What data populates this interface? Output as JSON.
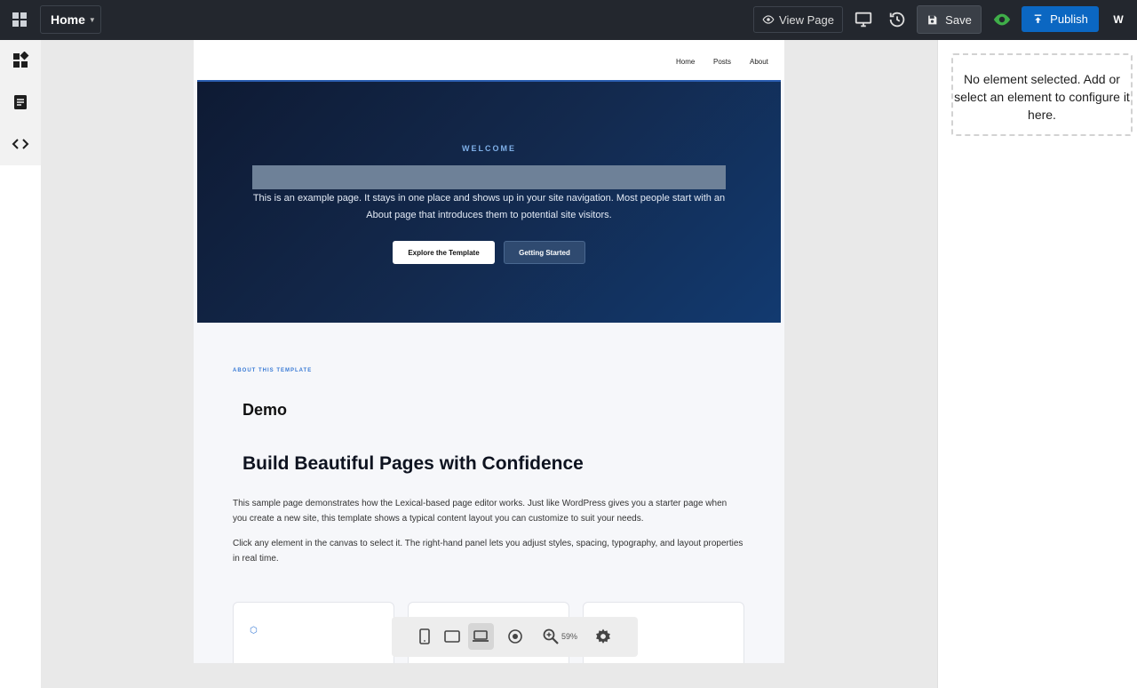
{
  "topbar": {
    "page_selector": "Home",
    "view_page": "View Page",
    "save": "Save",
    "publish": "Publish",
    "avatar": "W",
    "icons": [
      "dashboard-grid-icon",
      "eye-icon",
      "desktop-monitor-icon",
      "history-icon",
      "save-disk-icon",
      "visibility-eye-icon",
      "upload-icon"
    ]
  },
  "sidebar": {
    "icons": [
      "blocks-icon",
      "pages-document-icon",
      "code-icon"
    ]
  },
  "canvas": {
    "nav": {
      "items": [
        "Home",
        "Posts",
        "About"
      ]
    },
    "hero": {
      "welcome": "WELCOME",
      "text": "This is an example page. It stays in one place and shows up in your site navigation. Most people start with an About page that introduces them to potential site visitors.",
      "button_primary": "Explore the Template",
      "button_secondary": "Getting Started"
    },
    "about": {
      "label": "ABOUT THIS TEMPLATE",
      "demo_title": "Demo",
      "heading": "Build Beautiful Pages with Confidence",
      "paragraph_1": "This sample page demonstrates how the Lexical-based page editor works. Just like WordPress gives you a starter page when you create a new site, this template shows a typical content layout you can customize to suit your needs.",
      "paragraph_2": "Click any element in the canvas to select it. The right-hand panel lets you adjust styles, spacing, typography, and layout properties in real time."
    }
  },
  "floating_toolbar": {
    "zoom": "59%",
    "icons": [
      "mobile-icon",
      "tablet-icon",
      "laptop-icon",
      "target-icon",
      "zoom-in-icon",
      "settings-gear-icon"
    ],
    "active": "laptop"
  },
  "right_panel": {
    "empty_message": "No element selected. Add or select an element to configure it here."
  },
  "colors": {
    "topbar": "#23272e",
    "publish": "#0b67c2",
    "accent_green": "#3fae49",
    "hero_dark": "#0e1a33",
    "hero_blue": "#123a70"
  }
}
